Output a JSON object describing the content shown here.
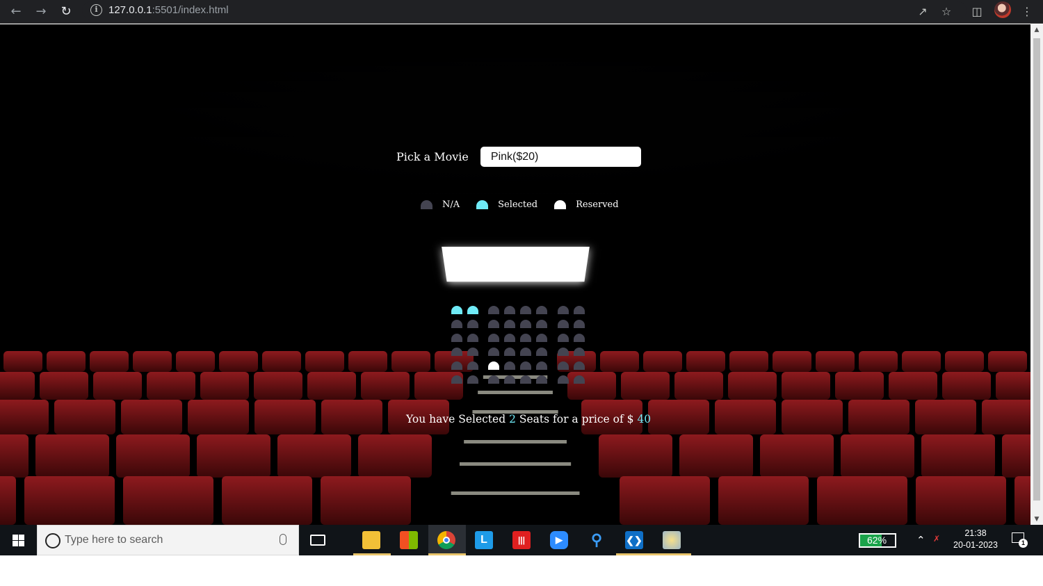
{
  "browser": {
    "url_host": "127.0.0.1",
    "url_rest": ":5501/index.html"
  },
  "page": {
    "movie_label": "Pick a Movie",
    "movie_selected": "Pink($20)",
    "legend": [
      {
        "label": "N/A",
        "color": "#444451"
      },
      {
        "label": "Selected",
        "color": "#6feaf6"
      },
      {
        "label": "Reserved",
        "color": "#ffffff"
      }
    ],
    "seat_rows": [
      [
        "selected",
        "selected",
        "na",
        "na",
        "na",
        "na",
        "na",
        "na"
      ],
      [
        "na",
        "na",
        "na",
        "na",
        "na",
        "na",
        "na",
        "na"
      ],
      [
        "na",
        "na",
        "na",
        "na",
        "na",
        "na",
        "na",
        "na"
      ],
      [
        "na",
        "na",
        "na",
        "na",
        "na",
        "na",
        "na",
        "na"
      ],
      [
        "na",
        "na",
        "occupied",
        "na",
        "na",
        "na",
        "na",
        "na"
      ],
      [
        "na",
        "na",
        "na",
        "na",
        "na",
        "na",
        "na",
        "na"
      ]
    ],
    "summary_prefix": "You have Selected ",
    "selected_count": "2",
    "summary_middle": " Seats for a price of $ ",
    "total_price": "40"
  },
  "taskbar": {
    "search_placeholder": "Type here to search",
    "battery": "62%",
    "time": "21:38",
    "date": "20-01-2023",
    "notification_count": "1"
  }
}
